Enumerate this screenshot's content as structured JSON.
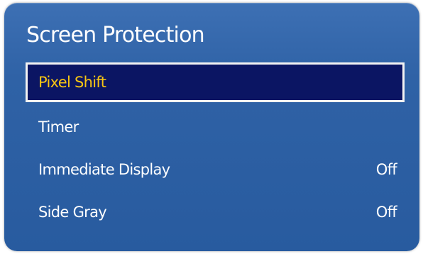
{
  "menu": {
    "title": "Screen Protection",
    "items": [
      {
        "label": "Pixel Shift",
        "value": ""
      },
      {
        "label": "Timer",
        "value": ""
      },
      {
        "label": "Immediate Display",
        "value": "Off"
      },
      {
        "label": "Side Gray",
        "value": "Off"
      }
    ],
    "selected_index": 0
  },
  "colors": {
    "panel_blue": "#2f62a6",
    "selection_background": "#0b1563",
    "selection_text": "#f7c413",
    "text": "#ffffff"
  }
}
